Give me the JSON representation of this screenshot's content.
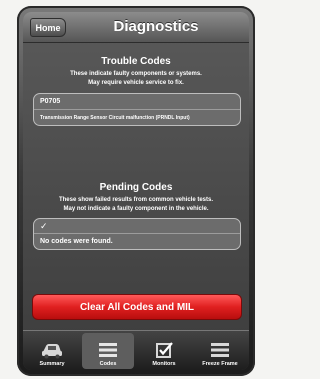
{
  "navbar": {
    "home_label": "Home",
    "title": "Diagnostics"
  },
  "trouble": {
    "title": "Trouble Codes",
    "subtitle_line1": "These indicate faulty components or systems.",
    "subtitle_line2": "May require vehicle service to fix.",
    "code": "P0705",
    "description": "Transmission Range Sensor Circuit malfunction (PRNDL Input)"
  },
  "pending": {
    "title": "Pending Codes",
    "subtitle_line1": "These show failed results from common vehicle tests.",
    "subtitle_line2": "May not indicate a faulty component in the vehicle.",
    "check_mark": "✓",
    "message": "No codes were found."
  },
  "clear_button": "Clear All Codes and MIL",
  "tabs": [
    {
      "label": "Summary",
      "icon": "car-icon",
      "active": false
    },
    {
      "label": "Codes",
      "icon": "list-icon",
      "active": true
    },
    {
      "label": "Monitors",
      "icon": "checkbox-icon",
      "active": false
    },
    {
      "label": "Freeze Frame",
      "icon": "list-icon",
      "active": false
    }
  ],
  "colors": {
    "clear_button": "#e02020",
    "background": "#3c3c3c"
  }
}
